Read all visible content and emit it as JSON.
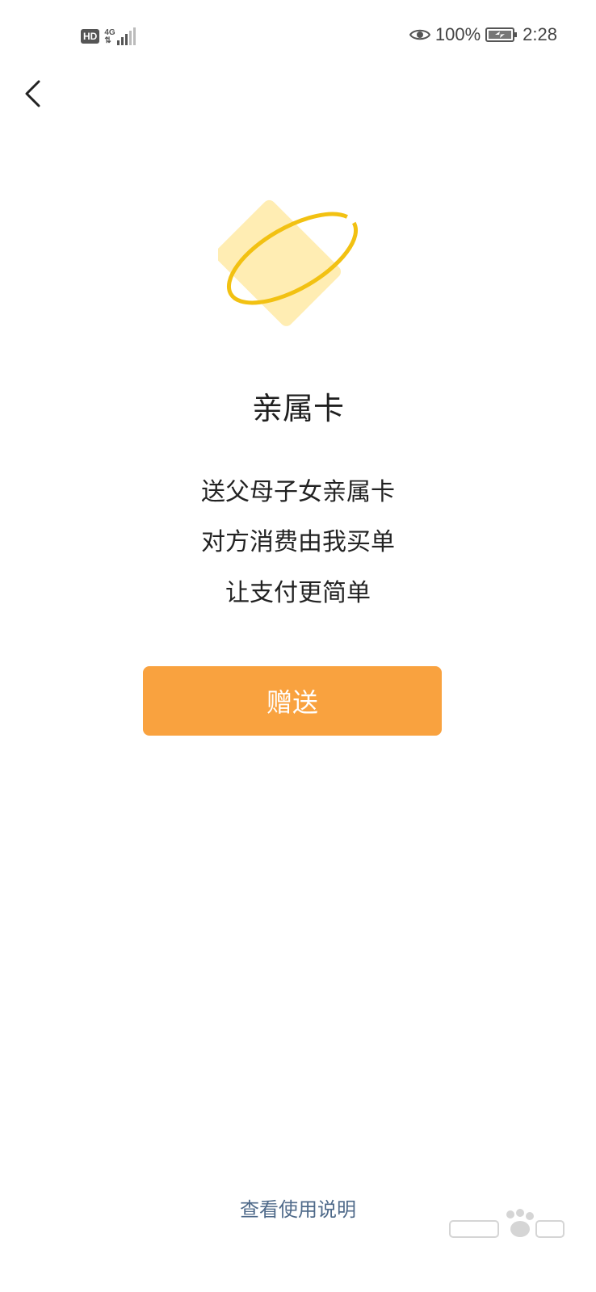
{
  "status_bar": {
    "hd_label": "HD",
    "network_label": "4G",
    "network_sub": "⇅",
    "battery_percent": "100%",
    "time": "2:28"
  },
  "content": {
    "title": "亲属卡",
    "description": [
      "送父母子女亲属卡",
      "对方消费由我买单",
      "让支付更简单"
    ],
    "gift_button_label": "赠送",
    "help_link_label": "查看使用说明"
  },
  "colors": {
    "accent": "#f9a23f",
    "card": "#ffedb3",
    "ring": "#f2c112",
    "link": "#4f6a8a"
  },
  "icons": {
    "back": "chevron-left-icon",
    "eye": "eye-icon",
    "battery": "battery-charging-icon",
    "hero": "card-orbit-illustration"
  }
}
